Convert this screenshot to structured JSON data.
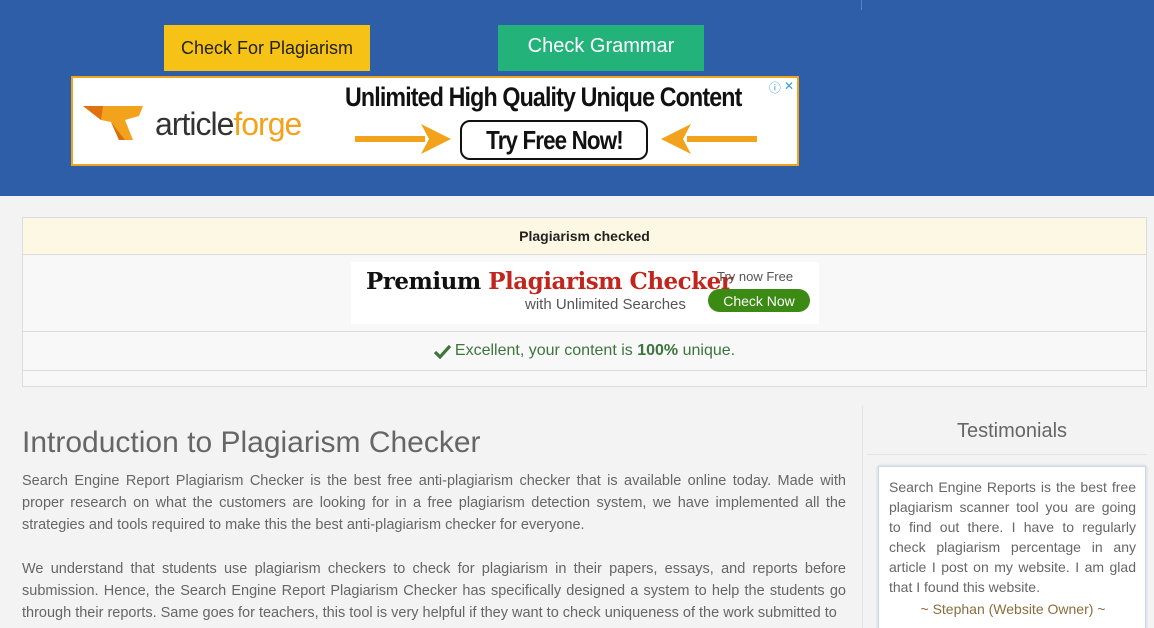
{
  "header": {
    "buttons": {
      "check_plagiarism": "Check For Plagiarism",
      "check_grammar": "Check Grammar"
    },
    "ad": {
      "brand_a": "article",
      "brand_b": "forge",
      "headline": "Unlimited High Quality Unique Content",
      "cta": "Try Free Now!",
      "info_icon": "ⓘ",
      "close_icon": "✕"
    }
  },
  "result_panel": {
    "title": "Plagiarism checked",
    "premium_ad": {
      "word1": "Premium",
      "word2": "Plagiarism Checker",
      "subline": "with Unlimited Searches",
      "try_label": "Try now Free",
      "button": "Check Now"
    },
    "result": {
      "prefix": "Excellent, your content is",
      "percent": "100%",
      "suffix": "unique."
    }
  },
  "main": {
    "title": "Introduction to Plagiarism Checker",
    "paragraph1": "Search Engine Report Plagiarism Checker is the best free anti-plagiarism checker that is available online today. Made with proper research on what the customers are looking for in a free plagiarism detection system, we have implemented all the strategies and tools required to make this the best anti-plagiarism checker for everyone.",
    "paragraph2": "We understand that students use plagiarism checkers to check for plagiarism in their papers, essays, and reports before submission. Hence, the Search Engine Report Plagiarism Checker has specifically designed a system to help the students go through their reports. Same goes for teachers, this tool is very helpful if they want to check uniqueness of the work submitted to"
  },
  "sidebar": {
    "title": "Testimonials",
    "quote": "Search Engine Reports is the best free plagiarism scanner tool you are going to find out there. I have to regularly check plagiarism percentage in any article I post on my website. I am glad that I found this website.",
    "author": "~ Stephan (Website Owner) ~"
  },
  "colors": {
    "header_bg": "#2e5ea8",
    "plagiarism_button": "#f6c216",
    "grammar_button": "#23b27a",
    "ad_orange": "#f2a31b",
    "success_green": "#3c763d"
  }
}
